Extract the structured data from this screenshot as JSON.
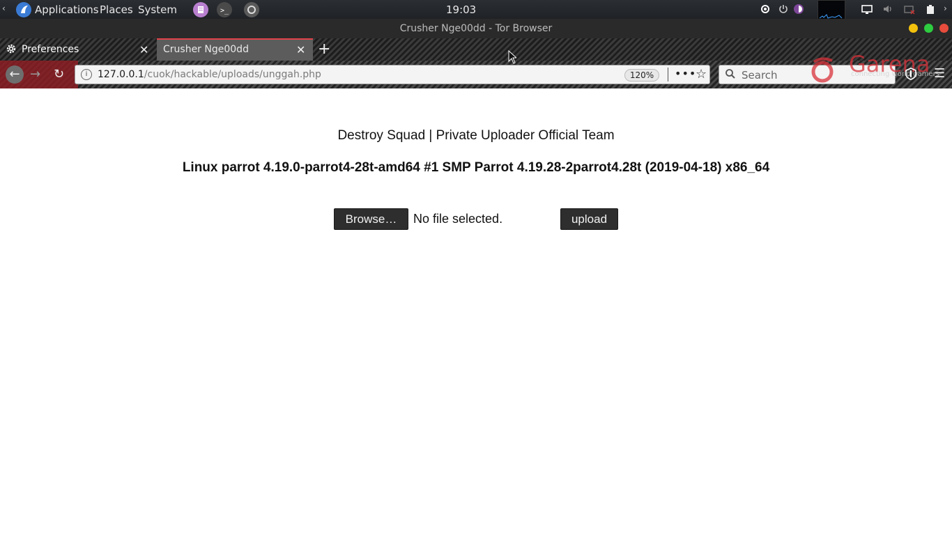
{
  "panel": {
    "menus": [
      "Applications",
      "Places",
      "System"
    ],
    "clock": "19:03"
  },
  "window": {
    "title": "Crusher Nge00dd - Tor Browser"
  },
  "tabs": [
    {
      "label": "Preferences",
      "icon": "gear-icon"
    },
    {
      "label": "Crusher Nge00dd",
      "active": true
    }
  ],
  "navbar": {
    "url_host": "127.0.0.1",
    "url_path": "/cuok/hackable/uploads/unggah.php",
    "zoom": "120%",
    "search_placeholder": "Search",
    "theme_logo_text": "Garena",
    "theme_tagline": "connecting world gamers"
  },
  "page": {
    "heading": "Destroy Squad | Private Uploader Official Team",
    "sysinfo": "Linux parrot 4.19.0-parrot4-28t-amd64 #1 SMP Parrot 4.19.28-2parrot4.28t (2019-04-18) x86_64",
    "browse_label": "Browse…",
    "file_status": "No file selected.",
    "upload_label": "upload"
  },
  "colors": {
    "active_tab_accent": "#e0434a",
    "button_bg": "#2e2e2e"
  }
}
